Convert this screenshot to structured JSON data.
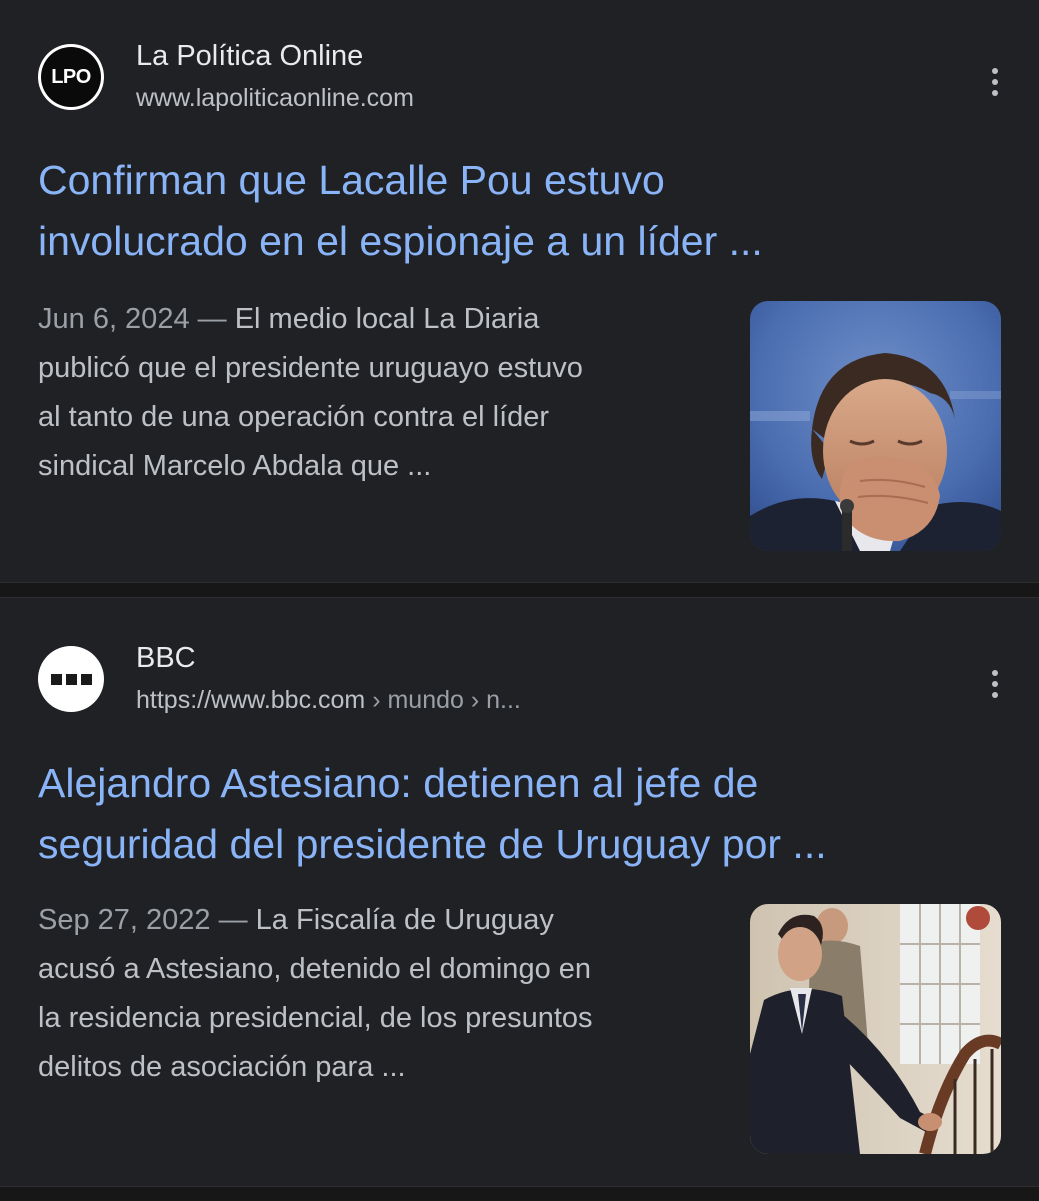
{
  "results": [
    {
      "site_name": "La Política Online",
      "site_url": "www.lapoliticaonline.com",
      "favicon_text": "LPO",
      "favicon_icon": "lpo-logo-icon",
      "title_lines": [
        "Confirman que Lacalle Pou estuvo",
        "involucrado en el espionaje a un líder ..."
      ],
      "date": "Jun 6, 2024",
      "dash": "—",
      "snippet_lines": [
        "El medio local La Diaria",
        "publicó que el presidente uruguayo estuvo",
        "al tanto de una operación contra el líder",
        "sindical Marcelo Abdala que ..."
      ],
      "thumbnail": "man-covering-mouth-photo"
    },
    {
      "site_name": "BBC",
      "site_url_base": "https://www.bbc.com",
      "site_url_crumbs": " › mundo › n...",
      "favicon_icon": "bbc-logo-icon",
      "title_lines": [
        "Alejandro Astesiano: detienen al jefe de",
        "seguridad del presidente de Uruguay por ..."
      ],
      "date": "Sep 27, 2022",
      "dash": "—",
      "snippet_lines": [
        "La Fiscalía de Uruguay",
        "acusó a Astesiano, detenido el domingo en",
        "la residencia presidencial, de los presuntos",
        "delitos de asociación para ..."
      ],
      "thumbnail": "man-on-staircase-photo"
    }
  ],
  "colors": {
    "background": "#202124",
    "title_link": "#8ab4f8",
    "snippet_text": "#bdc1c6",
    "site_name": "#e8eaed"
  }
}
